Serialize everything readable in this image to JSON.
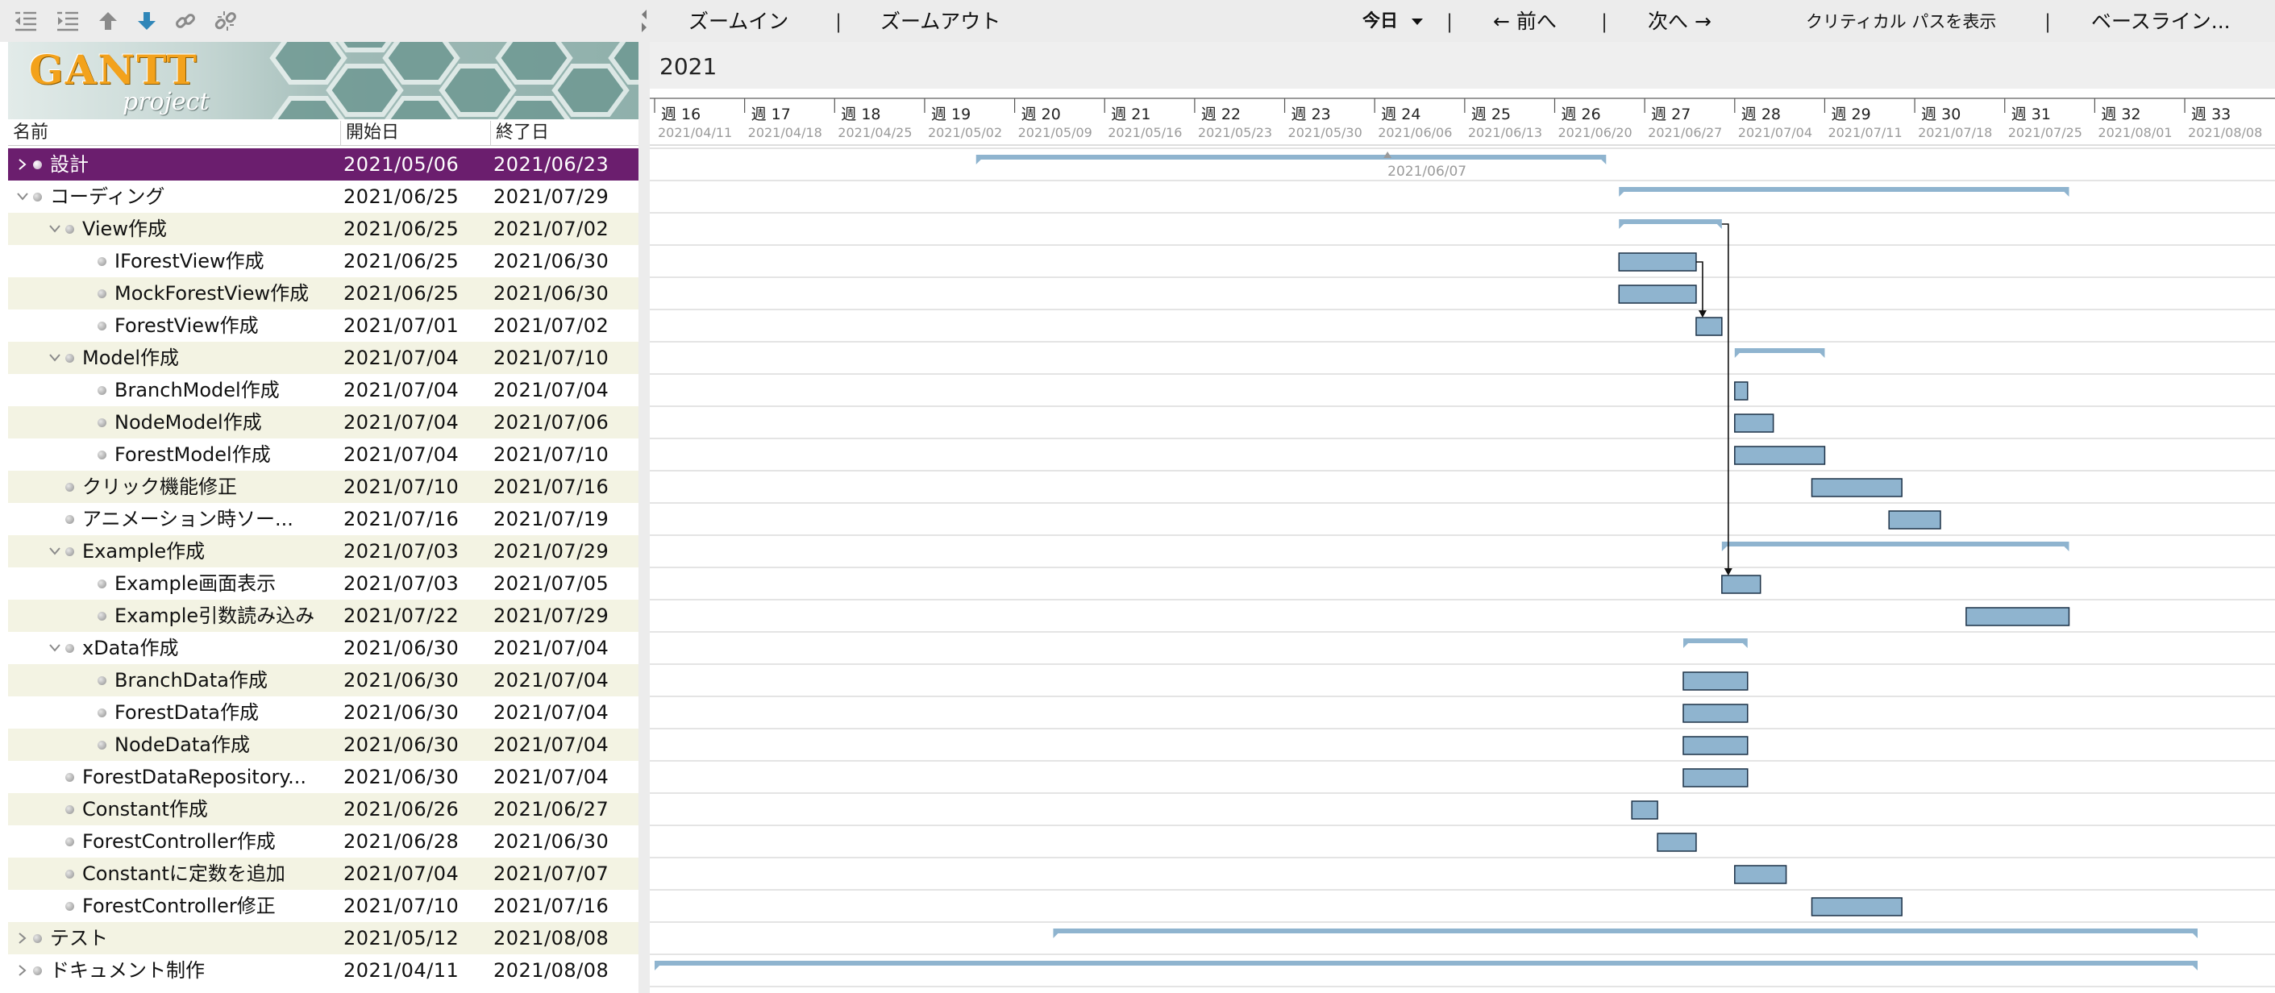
{
  "app": {
    "title": "GanttProject"
  },
  "logo": {
    "text": "GANTT",
    "subtitle": "project"
  },
  "left_toolbar": {
    "icons": [
      "unindent-icon",
      "indent-icon",
      "move-up-icon",
      "move-down-icon",
      "link-icon",
      "unlink-icon"
    ]
  },
  "table": {
    "columns": {
      "name": "名前",
      "start": "開始日",
      "end": "終了日"
    },
    "rows": [
      {
        "name": "設計",
        "start": "2021/05/06",
        "end": "2021/06/23",
        "level": 0,
        "expander": "closed",
        "selected": true
      },
      {
        "name": "コーディング",
        "start": "2021/06/25",
        "end": "2021/07/29",
        "level": 0,
        "expander": "open"
      },
      {
        "name": "View作成",
        "start": "2021/06/25",
        "end": "2021/07/02",
        "level": 1,
        "expander": "open"
      },
      {
        "name": "IForestView作成",
        "start": "2021/06/25",
        "end": "2021/06/30",
        "level": 2,
        "expander": "none"
      },
      {
        "name": "MockForestView作成",
        "start": "2021/06/25",
        "end": "2021/06/30",
        "level": 2,
        "expander": "none"
      },
      {
        "name": "ForestView作成",
        "start": "2021/07/01",
        "end": "2021/07/02",
        "level": 2,
        "expander": "none"
      },
      {
        "name": "Model作成",
        "start": "2021/07/04",
        "end": "2021/07/10",
        "level": 1,
        "expander": "open"
      },
      {
        "name": "BranchModel作成",
        "start": "2021/07/04",
        "end": "2021/07/04",
        "level": 2,
        "expander": "none"
      },
      {
        "name": "NodeModel作成",
        "start": "2021/07/04",
        "end": "2021/07/06",
        "level": 2,
        "expander": "none"
      },
      {
        "name": "ForestModel作成",
        "start": "2021/07/04",
        "end": "2021/07/10",
        "level": 2,
        "expander": "none"
      },
      {
        "name": "クリック機能修正",
        "start": "2021/07/10",
        "end": "2021/07/16",
        "level": 1,
        "expander": "none"
      },
      {
        "name": "アニメーション時ソー...",
        "start": "2021/07/16",
        "end": "2021/07/19",
        "level": 1,
        "expander": "none"
      },
      {
        "name": "Example作成",
        "start": "2021/07/03",
        "end": "2021/07/29",
        "level": 1,
        "expander": "open"
      },
      {
        "name": "Example画面表示",
        "start": "2021/07/03",
        "end": "2021/07/05",
        "level": 2,
        "expander": "none"
      },
      {
        "name": "Example引数読み込み",
        "start": "2021/07/22",
        "end": "2021/07/29",
        "level": 2,
        "expander": "none"
      },
      {
        "name": "xData作成",
        "start": "2021/06/30",
        "end": "2021/07/04",
        "level": 1,
        "expander": "open"
      },
      {
        "name": "BranchData作成",
        "start": "2021/06/30",
        "end": "2021/07/04",
        "level": 2,
        "expander": "none"
      },
      {
        "name": "ForestData作成",
        "start": "2021/06/30",
        "end": "2021/07/04",
        "level": 2,
        "expander": "none"
      },
      {
        "name": "NodeData作成",
        "start": "2021/06/30",
        "end": "2021/07/04",
        "level": 2,
        "expander": "none"
      },
      {
        "name": "ForestDataRepository...",
        "start": "2021/06/30",
        "end": "2021/07/04",
        "level": 1,
        "expander": "none"
      },
      {
        "name": "Constant作成",
        "start": "2021/06/26",
        "end": "2021/06/27",
        "level": 1,
        "expander": "none"
      },
      {
        "name": "ForestController作成",
        "start": "2021/06/28",
        "end": "2021/06/30",
        "level": 1,
        "expander": "none"
      },
      {
        "name": "Constantに定数を追加",
        "start": "2021/07/04",
        "end": "2021/07/07",
        "level": 1,
        "expander": "none"
      },
      {
        "name": "ForestController修正",
        "start": "2021/07/10",
        "end": "2021/07/16",
        "level": 1,
        "expander": "none"
      },
      {
        "name": "テスト",
        "start": "2021/05/12",
        "end": "2021/08/08",
        "level": 0,
        "expander": "closed"
      },
      {
        "name": "ドキュメント制作",
        "start": "2021/04/11",
        "end": "2021/08/08",
        "level": 0,
        "expander": "closed"
      }
    ]
  },
  "right_toolbar": {
    "zoom_in": "ズームイン",
    "zoom_out": "ズームアウト",
    "today": "今日",
    "prev": "← 前へ",
    "next": "次へ →",
    "critical_path": "クリティカル パスを表示",
    "baseline": "ベースライン..."
  },
  "timeline": {
    "year": "2021",
    "start_date": "2021/04/11",
    "weeks": [
      {
        "label": "週 16",
        "date": "2021/04/11"
      },
      {
        "label": "週 17",
        "date": "2021/04/18"
      },
      {
        "label": "週 18",
        "date": "2021/04/25"
      },
      {
        "label": "週 19",
        "date": "2021/05/02"
      },
      {
        "label": "週 20",
        "date": "2021/05/09"
      },
      {
        "label": "週 21",
        "date": "2021/05/16"
      },
      {
        "label": "週 22",
        "date": "2021/05/23"
      },
      {
        "label": "週 23",
        "date": "2021/05/30"
      },
      {
        "label": "週 24",
        "date": "2021/06/06"
      },
      {
        "label": "週 25",
        "date": "2021/06/13"
      },
      {
        "label": "週 26",
        "date": "2021/06/20"
      },
      {
        "label": "週 27",
        "date": "2021/06/27"
      },
      {
        "label": "週 28",
        "date": "2021/07/04"
      },
      {
        "label": "週 29",
        "date": "2021/07/11"
      },
      {
        "label": "週 30",
        "date": "2021/07/18"
      },
      {
        "label": "週 31",
        "date": "2021/07/25"
      },
      {
        "label": "週 32",
        "date": "2021/08/01"
      },
      {
        "label": "週 33",
        "date": "2021/08/08"
      }
    ],
    "marker_label": "2021/06/07"
  },
  "bars": [
    {
      "row": 0,
      "start": "2021/05/06",
      "end": "2021/06/23",
      "type": "summary"
    },
    {
      "row": 1,
      "start": "2021/06/25",
      "end": "2021/07/29",
      "type": "summary"
    },
    {
      "row": 2,
      "start": "2021/06/25",
      "end": "2021/07/02",
      "type": "summary"
    },
    {
      "row": 3,
      "start": "2021/06/25",
      "end": "2021/06/30",
      "type": "task"
    },
    {
      "row": 4,
      "start": "2021/06/25",
      "end": "2021/06/30",
      "type": "task"
    },
    {
      "row": 5,
      "start": "2021/07/01",
      "end": "2021/07/02",
      "type": "task"
    },
    {
      "row": 6,
      "start": "2021/07/04",
      "end": "2021/07/10",
      "type": "summary"
    },
    {
      "row": 7,
      "start": "2021/07/04",
      "end": "2021/07/04",
      "type": "task"
    },
    {
      "row": 8,
      "start": "2021/07/04",
      "end": "2021/07/06",
      "type": "task"
    },
    {
      "row": 9,
      "start": "2021/07/04",
      "end": "2021/07/10",
      "type": "task"
    },
    {
      "row": 10,
      "start": "2021/07/10",
      "end": "2021/07/16",
      "type": "task"
    },
    {
      "row": 11,
      "start": "2021/07/16",
      "end": "2021/07/19",
      "type": "task"
    },
    {
      "row": 12,
      "start": "2021/07/03",
      "end": "2021/07/29",
      "type": "summary"
    },
    {
      "row": 13,
      "start": "2021/07/03",
      "end": "2021/07/05",
      "type": "task"
    },
    {
      "row": 14,
      "start": "2021/07/22",
      "end": "2021/07/29",
      "type": "task"
    },
    {
      "row": 15,
      "start": "2021/06/30",
      "end": "2021/07/04",
      "type": "summary"
    },
    {
      "row": 16,
      "start": "2021/06/30",
      "end": "2021/07/04",
      "type": "task"
    },
    {
      "row": 17,
      "start": "2021/06/30",
      "end": "2021/07/04",
      "type": "task"
    },
    {
      "row": 18,
      "start": "2021/06/30",
      "end": "2021/07/04",
      "type": "task"
    },
    {
      "row": 19,
      "start": "2021/06/30",
      "end": "2021/07/04",
      "type": "task"
    },
    {
      "row": 20,
      "start": "2021/06/26",
      "end": "2021/06/27",
      "type": "task"
    },
    {
      "row": 21,
      "start": "2021/06/28",
      "end": "2021/06/30",
      "type": "task"
    },
    {
      "row": 22,
      "start": "2021/07/04",
      "end": "2021/07/07",
      "type": "task"
    },
    {
      "row": 23,
      "start": "2021/07/10",
      "end": "2021/07/16",
      "type": "task"
    },
    {
      "row": 24,
      "start": "2021/05/12",
      "end": "2021/08/08",
      "type": "summary"
    },
    {
      "row": 25,
      "start": "2021/04/11",
      "end": "2021/08/08",
      "type": "summary"
    }
  ],
  "dependencies": [
    {
      "from": 3,
      "to": 5
    },
    {
      "from": 2,
      "to": 13
    }
  ],
  "colors": {
    "bar_fill": "#8fb4cf",
    "bar_stroke": "#1c3147",
    "summary": "#8fb4cf",
    "selected_row": "#6b1e6e",
    "odd_row": "#f3f3e3",
    "dependency": "#111111",
    "grid": "#c8c8c8"
  }
}
